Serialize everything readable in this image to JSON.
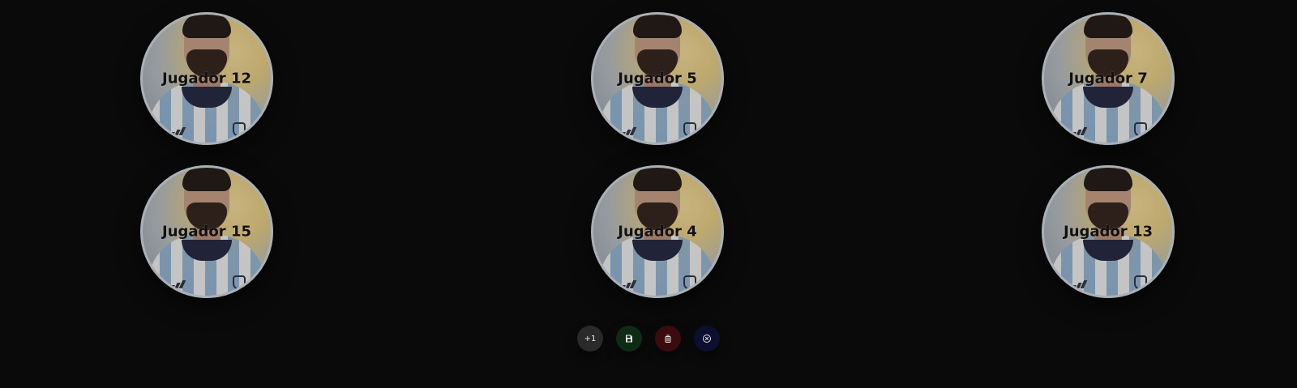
{
  "players": [
    {
      "label": "Jugador 12"
    },
    {
      "label": "Jugador 5"
    },
    {
      "label": "Jugador 7"
    },
    {
      "label": "Jugador 15"
    },
    {
      "label": "Jugador 4"
    },
    {
      "label": "Jugador 13"
    }
  ],
  "actions": {
    "add_label": "+1",
    "save_icon": "save-icon",
    "delete_icon": "trash-icon",
    "cancel_icon": "close-circle-icon"
  },
  "colors": {
    "background": "#0a0a0b",
    "add": "#2a2a2b",
    "save": "#0f2b14",
    "delete": "#3a0c0e",
    "cancel": "#0c0f2e"
  }
}
